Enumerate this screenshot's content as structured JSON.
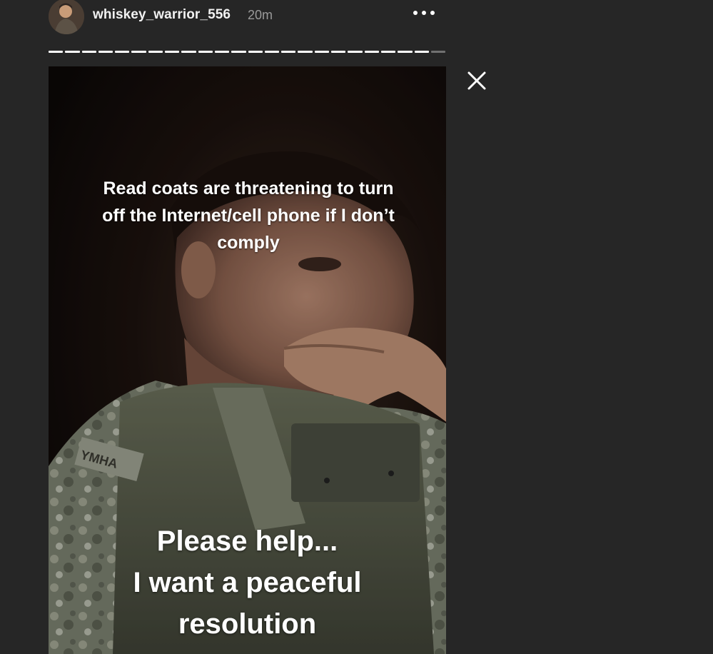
{
  "header": {
    "avatar_icon": "user-avatar",
    "username": "whiskey_warrior_556",
    "time_ago": "20m",
    "more_icon": "more-options-icon"
  },
  "progress": {
    "segments_total": 24,
    "segments_viewed": 23
  },
  "close_icon": "close-icon",
  "story": {
    "image_description_icon": "story-photo",
    "caption_top": [
      "Read coats are threatening to turn",
      "off the Internet/cell phone  if I don’t",
      "comply"
    ],
    "caption_bottom": [
      "Please help...",
      "I want a peaceful",
      "resolution"
    ],
    "patch_text": "YMHA"
  }
}
